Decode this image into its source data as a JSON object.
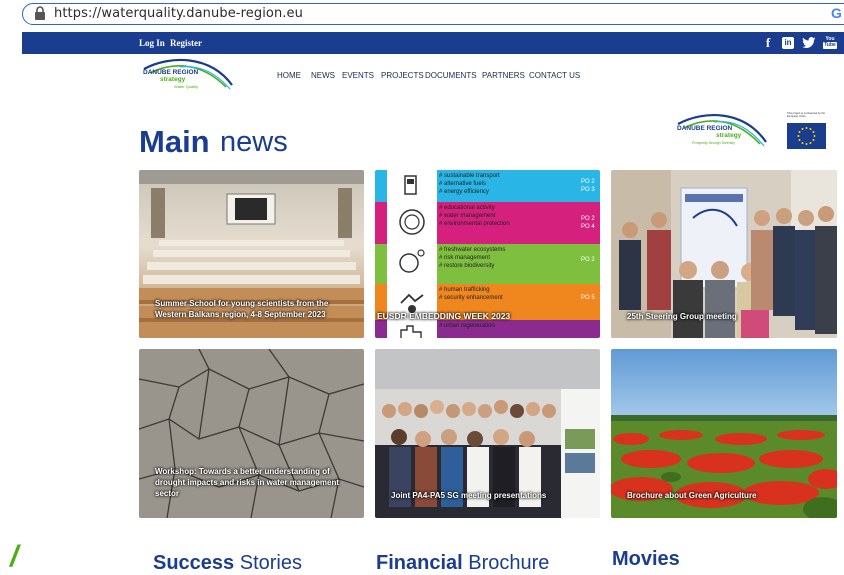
{
  "browser": {
    "url": "https://waterquality.danube-region.eu",
    "lock_icon": "lock-icon",
    "google_icon": "G"
  },
  "topbar": {
    "login": "Log In",
    "register": "Register",
    "social": [
      "f",
      "in",
      "t",
      "You Tube"
    ]
  },
  "nav": {
    "logo_line1": "DANUBE REGION",
    "logo_line2": "strategy",
    "logo_line3": "Water Quality",
    "items": [
      "HOME",
      "NEWS",
      "EVENTS",
      "PROJECTS",
      "DOCUMENTS",
      "PARTNERS",
      "CONTACT US"
    ]
  },
  "main": {
    "title_bold": "Main",
    "title_light": "news",
    "side_logo_line1": "DANUBE REGION",
    "side_logo_line2": "strategy",
    "side_logo_line3": "Prosperity through Diversity",
    "eu_note": "This project is co-financed by the European Union"
  },
  "cards": [
    {
      "caption": "Summer School for young scientists from the Western Balkans region, 4-8 September 2023"
    },
    {
      "caption": "EUSDR EMBEDDING WEEK 2023",
      "rows": [
        {
          "text": [
            "# sustainable transport",
            "# alternative fuels",
            "# energy efficiency"
          ],
          "po": "PO 2\nPO 3",
          "color": "#29b6e6"
        },
        {
          "text": [
            "# educational activity",
            "# water management",
            "# environmental protection"
          ],
          "po": "PO 2\nPO 4",
          "color": "#d6207d"
        },
        {
          "text": [
            "# freshwater ecosystems",
            "# risk management",
            "# restore biodiversity"
          ],
          "po": "PO 2",
          "color": "#7fbf3f"
        },
        {
          "text": [
            "# human trafficking",
            "# security enhancement"
          ],
          "po": "PO 5",
          "color": "#f0871e"
        },
        {
          "text": [
            "# urban regeneration"
          ],
          "po": "",
          "color": "#8b2a8f"
        }
      ]
    },
    {
      "caption": "25th Steering Group meeting"
    },
    {
      "caption": "Workshop: Towards a better understanding of drought impacts and risks in water management sector"
    },
    {
      "caption": "Joint PA4-PA5 SG meeting presentations"
    },
    {
      "caption": "Brochure about Green Agriculture"
    }
  ],
  "sections": {
    "success_bold": "Success",
    "success_light": "Stories",
    "financial_bold": "Financial",
    "financial_light": "Brochure",
    "movies": "Movies"
  },
  "colors": {
    "brand_blue": "#1a3d8f",
    "accent_green": "#4caf1a"
  }
}
